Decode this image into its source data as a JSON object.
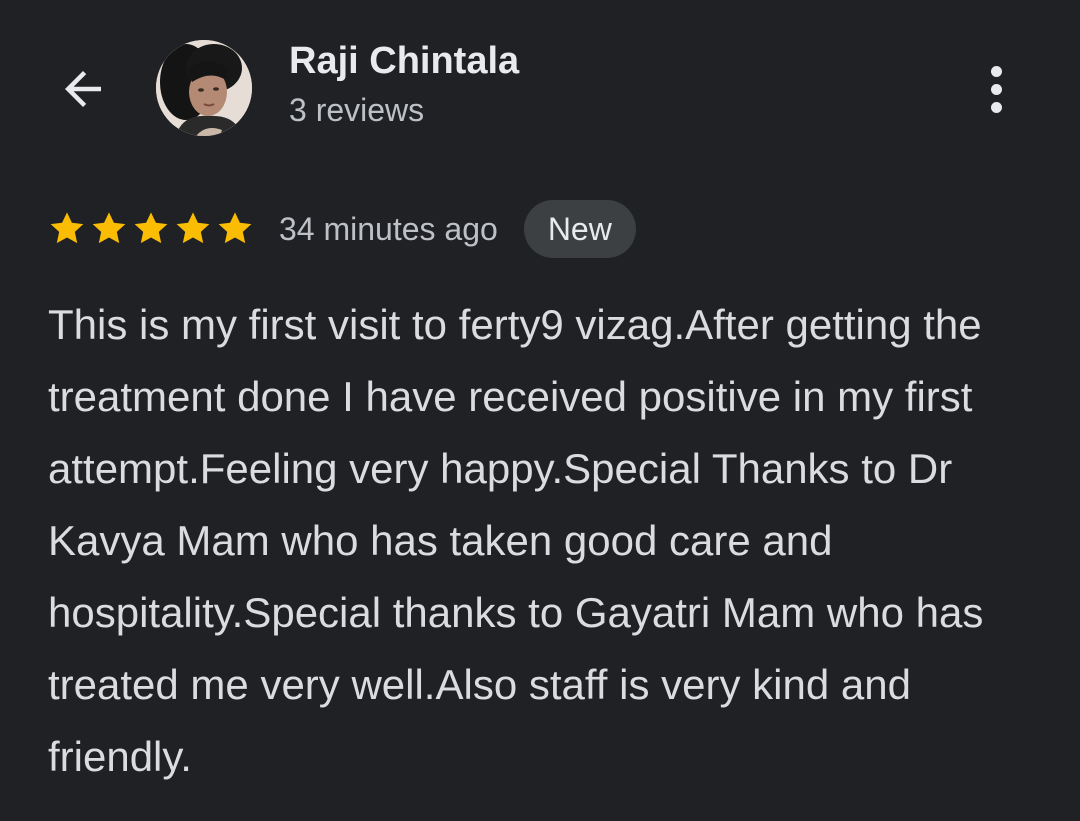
{
  "header": {
    "back_icon": "arrow-back-icon",
    "avatar_icon": "reviewer-avatar",
    "more_icon": "more-vert-icon"
  },
  "reviewer": {
    "name": "Raji Chintala",
    "review_count": "3 reviews"
  },
  "review": {
    "rating": 5,
    "rating_max": 5,
    "timestamp": "34 minutes ago",
    "badge": "New",
    "text": "This is my first visit to ferty9 vizag.After getting the treatment done I have received positive in my first attempt.Feeling very happy.Special Thanks to Dr Kavya Mam who has taken good care and hospitality.Special thanks to Gayatri Mam who has treated me very well.Also staff is very kind and friendly."
  },
  "colors": {
    "background": "#202124",
    "star": "#fbbc04",
    "badge_background": "#3c4043",
    "primary_text": "#e8eaed",
    "secondary_text": "#bdc1c6"
  }
}
